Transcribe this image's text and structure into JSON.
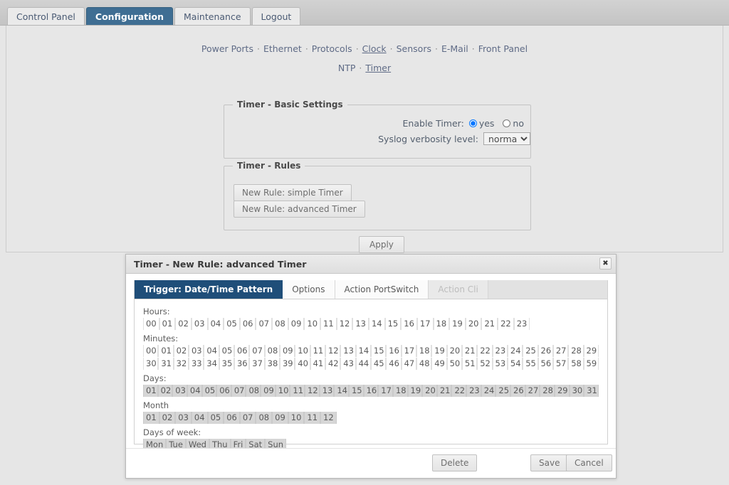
{
  "main_tabs": [
    {
      "label": "Control Panel",
      "active": false
    },
    {
      "label": "Configuration",
      "active": true
    },
    {
      "label": "Maintenance",
      "active": false
    },
    {
      "label": "Logout",
      "active": false
    }
  ],
  "nav": {
    "row1": [
      "Power Ports",
      "Ethernet",
      "Protocols",
      "Clock",
      "Sensors",
      "E-Mail",
      "Front Panel"
    ],
    "row1_current": "Clock",
    "row2": [
      "NTP",
      "Timer"
    ],
    "row2_current": "Timer",
    "separator": "·"
  },
  "basic_settings": {
    "legend": "Timer - Basic Settings",
    "enable_label": "Enable Timer:",
    "enable_yes": "yes",
    "enable_no": "no",
    "enable_value": "yes",
    "verbosity_label": "Syslog verbosity level:",
    "verbosity_value": "normal",
    "verbosity_options": [
      "normal"
    ]
  },
  "rules": {
    "legend": "Timer - Rules",
    "new_simple": "New Rule: simple Timer",
    "new_advanced": "New Rule: advanced Timer"
  },
  "apply_label": "Apply",
  "dialog": {
    "title": "Timer - New Rule: advanced Timer",
    "close_icon": "close-icon",
    "close_glyph": "✖",
    "tabs": [
      {
        "label": "Trigger: Date/Time Pattern",
        "state": "active"
      },
      {
        "label": "Options",
        "state": "plain"
      },
      {
        "label": "Action PortSwitch",
        "state": "plain"
      },
      {
        "label": "Action Cli",
        "state": "disabled"
      }
    ],
    "groups": {
      "hours": {
        "label": "Hours:",
        "values": [
          "00",
          "01",
          "02",
          "03",
          "04",
          "05",
          "06",
          "07",
          "08",
          "09",
          "10",
          "11",
          "12",
          "13",
          "14",
          "15",
          "16",
          "17",
          "18",
          "19",
          "20",
          "21",
          "22",
          "23"
        ],
        "selected": []
      },
      "minutes": {
        "label": "Minutes:",
        "row1": [
          "00",
          "01",
          "02",
          "03",
          "04",
          "05",
          "06",
          "07",
          "08",
          "09",
          "10",
          "11",
          "12",
          "13",
          "14",
          "15",
          "16",
          "17",
          "18",
          "19",
          "20",
          "21",
          "22",
          "23",
          "24",
          "25",
          "26",
          "27",
          "28",
          "29"
        ],
        "row2": [
          "30",
          "31",
          "32",
          "33",
          "34",
          "35",
          "36",
          "37",
          "38",
          "39",
          "40",
          "41",
          "42",
          "43",
          "44",
          "45",
          "46",
          "47",
          "48",
          "49",
          "50",
          "51",
          "52",
          "53",
          "54",
          "55",
          "56",
          "57",
          "58",
          "59"
        ],
        "selected": []
      },
      "days": {
        "label": "Days:",
        "values": [
          "01",
          "02",
          "03",
          "04",
          "05",
          "06",
          "07",
          "08",
          "09",
          "10",
          "11",
          "12",
          "13",
          "14",
          "15",
          "16",
          "17",
          "18",
          "19",
          "20",
          "21",
          "22",
          "23",
          "24",
          "25",
          "26",
          "27",
          "28",
          "29",
          "30",
          "31"
        ],
        "all_selected": true
      },
      "month": {
        "label": "Month",
        "values": [
          "01",
          "02",
          "03",
          "04",
          "05",
          "06",
          "07",
          "08",
          "09",
          "10",
          "11",
          "12"
        ],
        "all_selected": true
      },
      "weekdays": {
        "label": "Days of week:",
        "values": [
          "Mon",
          "Tue",
          "Wed",
          "Thu",
          "Fri",
          "Sat",
          "Sun"
        ],
        "all_selected": true
      }
    },
    "buttons": {
      "delete": "Delete",
      "save": "Save",
      "cancel": "Cancel"
    }
  },
  "colors": {
    "accent_tab": "#3f6e93",
    "dialog_accent": "#1f4e79",
    "page_bg": "#e6e6e6",
    "cell_selected": "#d6d6d6"
  }
}
